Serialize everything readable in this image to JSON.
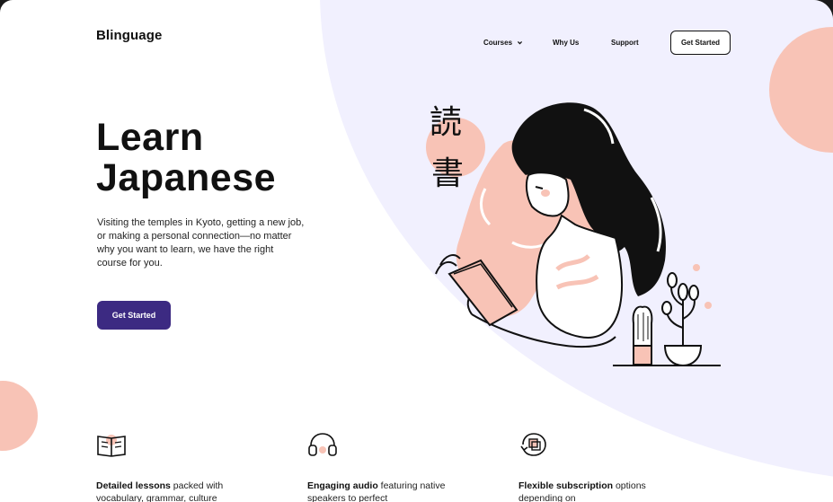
{
  "brand": {
    "logo": "Blinguage"
  },
  "nav": {
    "courses": "Courses",
    "why_us": "Why Us",
    "support": "Support",
    "cta": "Get Started"
  },
  "hero": {
    "title_line1": "Learn",
    "title_line2": "Japanese",
    "description": "Visiting the temples in Kyoto, getting a new job, or making a personal connection—no matter why you want to learn, we have the right course for you.",
    "cta": "Get Started",
    "kanji_top": "読",
    "kanji_bottom": "書"
  },
  "features": [
    {
      "icon": "book-icon",
      "title": "Detailed lessons",
      "text": " packed with vocabulary, grammar, culture"
    },
    {
      "icon": "headphones-icon",
      "title": "Engaging audio",
      "text": " featuring native speakers to perfect"
    },
    {
      "icon": "refresh-icon",
      "title": "Flexible subscription",
      "text": " options depending on"
    }
  ],
  "colors": {
    "accent": "#3c2a82",
    "peach": "#f8c3b6",
    "lavender": "#f1f0fe"
  }
}
